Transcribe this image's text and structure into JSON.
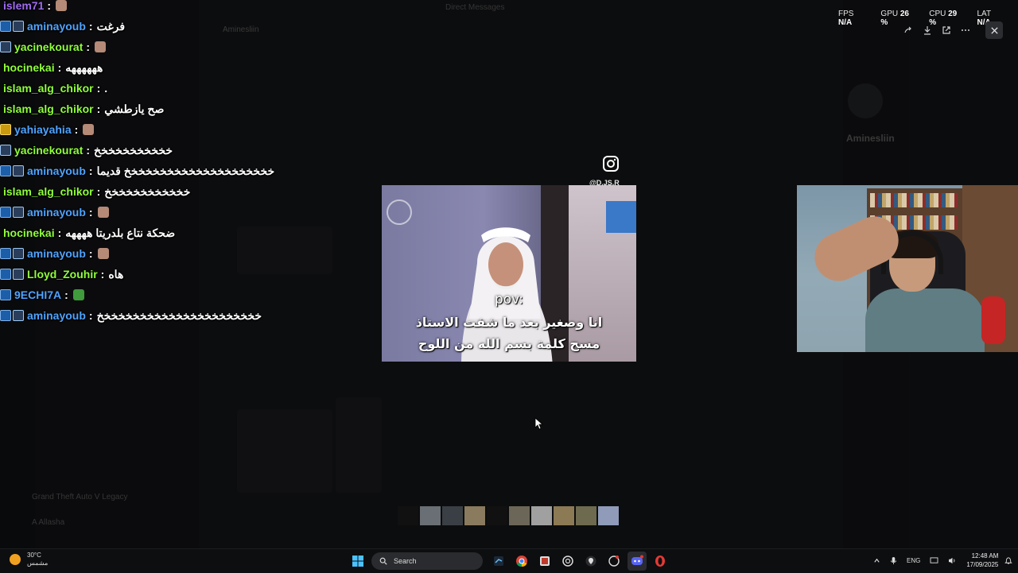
{
  "background": {
    "dm_title": "Direct Messages",
    "dm_header": "Aminesliin",
    "profile_name": "Aminesliin",
    "game": "Grand Theft Auto V Legacy",
    "username": "A Allasha"
  },
  "chat": {
    "messages": [
      {
        "badges": [],
        "user": "islem71",
        "color": "#9f6cf0",
        "text": "",
        "emote": true
      },
      {
        "badges": [
          "prime",
          "stat"
        ],
        "user": "aminayoub",
        "color": "#4fa3ff",
        "text": "فرغت",
        "emote": false
      },
      {
        "badges": [
          "stat"
        ],
        "user": "yacinekourat",
        "color": "#8fff3b",
        "text": "",
        "emote": true
      },
      {
        "badges": [],
        "user": "hocinekai",
        "color": "#8fff3b",
        "text": "ههههههه",
        "emote": false
      },
      {
        "badges": [],
        "user": "islam_alg_chikor",
        "color": "#8fff3b",
        "text": ".",
        "emote": false
      },
      {
        "badges": [],
        "user": "islam_alg_chikor",
        "color": "#8fff3b",
        "text": "صح يازطشي",
        "emote": false
      },
      {
        "badges": [
          "crown"
        ],
        "user": "yahiayahia",
        "color": "#4fa3ff",
        "text": "",
        "emote": true
      },
      {
        "badges": [
          "stat"
        ],
        "user": "yacinekourat",
        "color": "#8fff3b",
        "text": "خخخخخخخخخخخ",
        "emote": false
      },
      {
        "badges": [
          "prime",
          "stat"
        ],
        "user": "aminayoub",
        "color": "#4fa3ff",
        "text": "خخخخخخخخخخخخخخخخخخخخخ قديما",
        "emote": false
      },
      {
        "badges": [],
        "user": "islam_alg_chikor",
        "color": "#8fff3b",
        "text": "خخخخخخخخخخخخ",
        "emote": false
      },
      {
        "badges": [
          "prime",
          "stat"
        ],
        "user": "aminayoub",
        "color": "#4fa3ff",
        "text": "",
        "emote": true
      },
      {
        "badges": [],
        "user": "hocinekai",
        "color": "#8fff3b",
        "text": "ضحكة نتاع بلدريتا ههههه",
        "emote": false
      },
      {
        "badges": [
          "prime",
          "stat"
        ],
        "user": "aminayoub",
        "color": "#4fa3ff",
        "text": "",
        "emote": true
      },
      {
        "badges": [
          "prime",
          "stat"
        ],
        "user": "Lloyd_Zouhir",
        "color": "#8fff3b",
        "text": "هاه",
        "emote": false
      },
      {
        "badges": [
          "prime"
        ],
        "user": "9ECHI7A",
        "color": "#4fa3ff",
        "text": "",
        "emote": true,
        "emote_color": "green"
      },
      {
        "badges": [
          "prime",
          "stat"
        ],
        "user": "aminayoub",
        "color": "#4fa3ff",
        "text": "خخخخخخخخخخخخخخخخخخخخخخخ",
        "emote": false
      }
    ],
    "separator": ":"
  },
  "stats": [
    {
      "label": "FPS",
      "value": "N/A"
    },
    {
      "label": "GPU",
      "value": "26 %"
    },
    {
      "label": "CPU",
      "value": "29 %"
    },
    {
      "label": "LAT",
      "value": "N/A"
    }
  ],
  "video": {
    "handle": "@D.JS.R",
    "pov": "pov:",
    "line1": "انا وصغير بعد ما شفت الاستاذ",
    "line2": "مسح كلمة بسم الله من اللوح"
  },
  "taskbar": {
    "temp": "30°C",
    "weather": "مشمس",
    "search": "Search",
    "lang": "ENG",
    "time": "12:48 AM",
    "date": "17/09/2025"
  },
  "colors": {
    "prime_badge": "#1d5ea8",
    "crown_badge": "#c99a10",
    "taskbar": "#0d0e10"
  }
}
